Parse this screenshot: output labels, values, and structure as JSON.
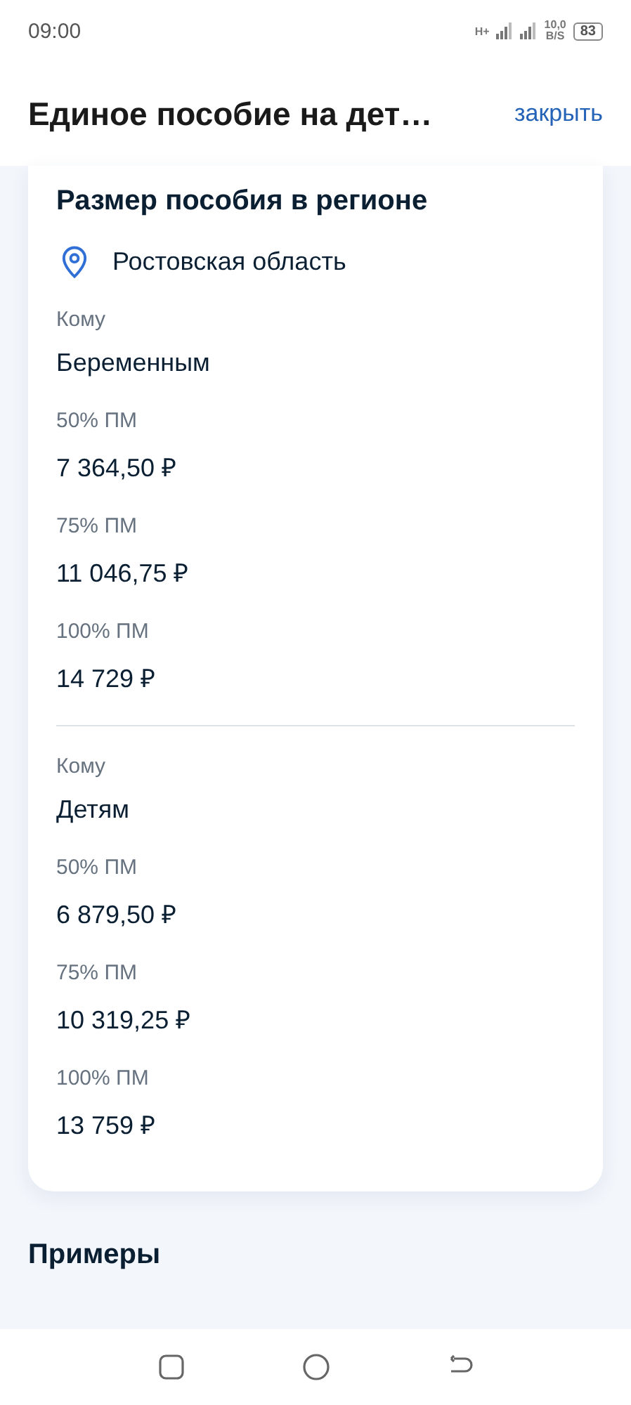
{
  "status_bar": {
    "time": "09:00",
    "network": "H+",
    "speed_value": "10,0",
    "speed_unit": "B/S",
    "battery": "83"
  },
  "header": {
    "title": "Единое пособие на дет…",
    "close": "закрыть"
  },
  "card": {
    "title": "Размер пособия в регионе",
    "region": "Ростовская область",
    "groups": [
      {
        "fields": [
          {
            "label": "Кому",
            "value": "Беременным"
          },
          {
            "label": "50% ПМ",
            "value": "7 364,50 ₽"
          },
          {
            "label": "75% ПМ",
            "value": "11 046,75 ₽"
          },
          {
            "label": "100% ПМ",
            "value": "14 729 ₽"
          }
        ]
      },
      {
        "fields": [
          {
            "label": "Кому",
            "value": "Детям"
          },
          {
            "label": "50% ПМ",
            "value": "6 879,50 ₽"
          },
          {
            "label": "75% ПМ",
            "value": "10 319,25 ₽"
          },
          {
            "label": "100% ПМ",
            "value": "13 759 ₽"
          }
        ]
      }
    ]
  },
  "next_section": {
    "title": "Примеры"
  }
}
